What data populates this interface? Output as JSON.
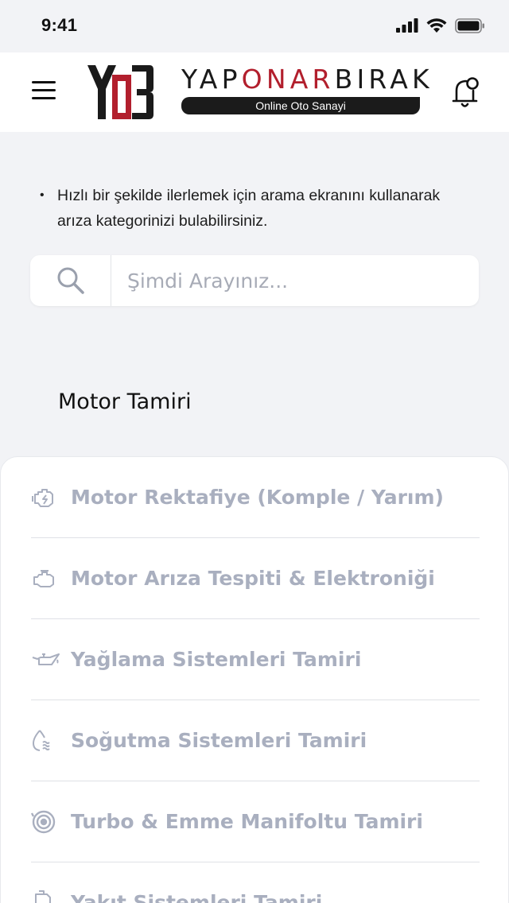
{
  "status_bar": {
    "time": "9:41"
  },
  "header": {
    "brand_prefix": "YAP",
    "brand_accent": "ONAR",
    "brand_suffix": "BIRAK",
    "tagline": "Online Oto Sanayi"
  },
  "info": {
    "bullet": "•",
    "text": "Hızlı bir şekilde ilerlemek için arama ekranını kullanarak arıza kategorinizi bulabilirsiniz."
  },
  "search": {
    "placeholder": "Şimdi Arayınız..."
  },
  "section": {
    "title": "Motor Tamiri"
  },
  "categories": [
    {
      "label": "Motor Rektafiye (Komple / Yarım)",
      "icon": "engine-repair-icon"
    },
    {
      "label": "Motor Arıza Tespiti & Elektroniği",
      "icon": "engine-check-icon"
    },
    {
      "label": "Yağlama Sistemleri Tamiri",
      "icon": "oil-can-icon"
    },
    {
      "label": "Soğutma Sistemleri Tamiri",
      "icon": "coolant-icon"
    },
    {
      "label": "Turbo & Emme Manifoltu Tamiri",
      "icon": "turbo-icon"
    },
    {
      "label": "Yakıt Sistemleri Tamiri",
      "icon": "fuel-icon"
    }
  ],
  "colors": {
    "brand_red": "#b21f2d",
    "background": "#f2f3f6",
    "list_text": "#a9afbf",
    "dark": "#1b1b1b"
  }
}
